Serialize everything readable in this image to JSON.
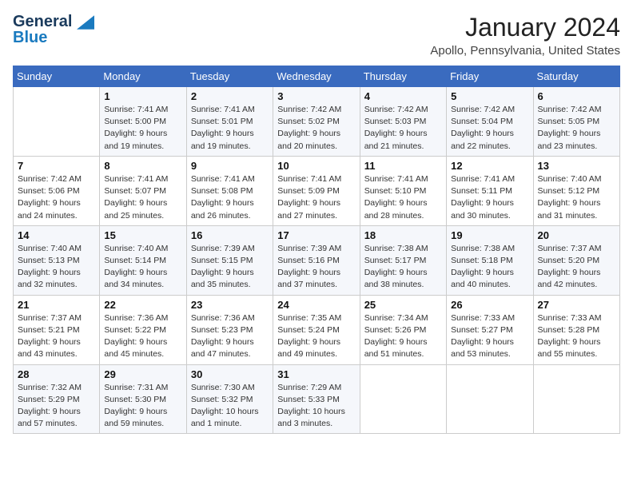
{
  "header": {
    "logo_line1": "General",
    "logo_line2": "Blue",
    "calendar_title": "January 2024",
    "calendar_subtitle": "Apollo, Pennsylvania, United States"
  },
  "weekdays": [
    "Sunday",
    "Monday",
    "Tuesday",
    "Wednesday",
    "Thursday",
    "Friday",
    "Saturday"
  ],
  "weeks": [
    [
      {
        "day": "",
        "sunrise": "",
        "sunset": "",
        "daylight": ""
      },
      {
        "day": "1",
        "sunrise": "Sunrise: 7:41 AM",
        "sunset": "Sunset: 5:00 PM",
        "daylight": "Daylight: 9 hours and 19 minutes."
      },
      {
        "day": "2",
        "sunrise": "Sunrise: 7:41 AM",
        "sunset": "Sunset: 5:01 PM",
        "daylight": "Daylight: 9 hours and 19 minutes."
      },
      {
        "day": "3",
        "sunrise": "Sunrise: 7:42 AM",
        "sunset": "Sunset: 5:02 PM",
        "daylight": "Daylight: 9 hours and 20 minutes."
      },
      {
        "day": "4",
        "sunrise": "Sunrise: 7:42 AM",
        "sunset": "Sunset: 5:03 PM",
        "daylight": "Daylight: 9 hours and 21 minutes."
      },
      {
        "day": "5",
        "sunrise": "Sunrise: 7:42 AM",
        "sunset": "Sunset: 5:04 PM",
        "daylight": "Daylight: 9 hours and 22 minutes."
      },
      {
        "day": "6",
        "sunrise": "Sunrise: 7:42 AM",
        "sunset": "Sunset: 5:05 PM",
        "daylight": "Daylight: 9 hours and 23 minutes."
      }
    ],
    [
      {
        "day": "7",
        "sunrise": "Sunrise: 7:42 AM",
        "sunset": "Sunset: 5:06 PM",
        "daylight": "Daylight: 9 hours and 24 minutes."
      },
      {
        "day": "8",
        "sunrise": "Sunrise: 7:41 AM",
        "sunset": "Sunset: 5:07 PM",
        "daylight": "Daylight: 9 hours and 25 minutes."
      },
      {
        "day": "9",
        "sunrise": "Sunrise: 7:41 AM",
        "sunset": "Sunset: 5:08 PM",
        "daylight": "Daylight: 9 hours and 26 minutes."
      },
      {
        "day": "10",
        "sunrise": "Sunrise: 7:41 AM",
        "sunset": "Sunset: 5:09 PM",
        "daylight": "Daylight: 9 hours and 27 minutes."
      },
      {
        "day": "11",
        "sunrise": "Sunrise: 7:41 AM",
        "sunset": "Sunset: 5:10 PM",
        "daylight": "Daylight: 9 hours and 28 minutes."
      },
      {
        "day": "12",
        "sunrise": "Sunrise: 7:41 AM",
        "sunset": "Sunset: 5:11 PM",
        "daylight": "Daylight: 9 hours and 30 minutes."
      },
      {
        "day": "13",
        "sunrise": "Sunrise: 7:40 AM",
        "sunset": "Sunset: 5:12 PM",
        "daylight": "Daylight: 9 hours and 31 minutes."
      }
    ],
    [
      {
        "day": "14",
        "sunrise": "Sunrise: 7:40 AM",
        "sunset": "Sunset: 5:13 PM",
        "daylight": "Daylight: 9 hours and 32 minutes."
      },
      {
        "day": "15",
        "sunrise": "Sunrise: 7:40 AM",
        "sunset": "Sunset: 5:14 PM",
        "daylight": "Daylight: 9 hours and 34 minutes."
      },
      {
        "day": "16",
        "sunrise": "Sunrise: 7:39 AM",
        "sunset": "Sunset: 5:15 PM",
        "daylight": "Daylight: 9 hours and 35 minutes."
      },
      {
        "day": "17",
        "sunrise": "Sunrise: 7:39 AM",
        "sunset": "Sunset: 5:16 PM",
        "daylight": "Daylight: 9 hours and 37 minutes."
      },
      {
        "day": "18",
        "sunrise": "Sunrise: 7:38 AM",
        "sunset": "Sunset: 5:17 PM",
        "daylight": "Daylight: 9 hours and 38 minutes."
      },
      {
        "day": "19",
        "sunrise": "Sunrise: 7:38 AM",
        "sunset": "Sunset: 5:18 PM",
        "daylight": "Daylight: 9 hours and 40 minutes."
      },
      {
        "day": "20",
        "sunrise": "Sunrise: 7:37 AM",
        "sunset": "Sunset: 5:20 PM",
        "daylight": "Daylight: 9 hours and 42 minutes."
      }
    ],
    [
      {
        "day": "21",
        "sunrise": "Sunrise: 7:37 AM",
        "sunset": "Sunset: 5:21 PM",
        "daylight": "Daylight: 9 hours and 43 minutes."
      },
      {
        "day": "22",
        "sunrise": "Sunrise: 7:36 AM",
        "sunset": "Sunset: 5:22 PM",
        "daylight": "Daylight: 9 hours and 45 minutes."
      },
      {
        "day": "23",
        "sunrise": "Sunrise: 7:36 AM",
        "sunset": "Sunset: 5:23 PM",
        "daylight": "Daylight: 9 hours and 47 minutes."
      },
      {
        "day": "24",
        "sunrise": "Sunrise: 7:35 AM",
        "sunset": "Sunset: 5:24 PM",
        "daylight": "Daylight: 9 hours and 49 minutes."
      },
      {
        "day": "25",
        "sunrise": "Sunrise: 7:34 AM",
        "sunset": "Sunset: 5:26 PM",
        "daylight": "Daylight: 9 hours and 51 minutes."
      },
      {
        "day": "26",
        "sunrise": "Sunrise: 7:33 AM",
        "sunset": "Sunset: 5:27 PM",
        "daylight": "Daylight: 9 hours and 53 minutes."
      },
      {
        "day": "27",
        "sunrise": "Sunrise: 7:33 AM",
        "sunset": "Sunset: 5:28 PM",
        "daylight": "Daylight: 9 hours and 55 minutes."
      }
    ],
    [
      {
        "day": "28",
        "sunrise": "Sunrise: 7:32 AM",
        "sunset": "Sunset: 5:29 PM",
        "daylight": "Daylight: 9 hours and 57 minutes."
      },
      {
        "day": "29",
        "sunrise": "Sunrise: 7:31 AM",
        "sunset": "Sunset: 5:30 PM",
        "daylight": "Daylight: 9 hours and 59 minutes."
      },
      {
        "day": "30",
        "sunrise": "Sunrise: 7:30 AM",
        "sunset": "Sunset: 5:32 PM",
        "daylight": "Daylight: 10 hours and 1 minute."
      },
      {
        "day": "31",
        "sunrise": "Sunrise: 7:29 AM",
        "sunset": "Sunset: 5:33 PM",
        "daylight": "Daylight: 10 hours and 3 minutes."
      },
      {
        "day": "",
        "sunrise": "",
        "sunset": "",
        "daylight": ""
      },
      {
        "day": "",
        "sunrise": "",
        "sunset": "",
        "daylight": ""
      },
      {
        "day": "",
        "sunrise": "",
        "sunset": "",
        "daylight": ""
      }
    ]
  ]
}
